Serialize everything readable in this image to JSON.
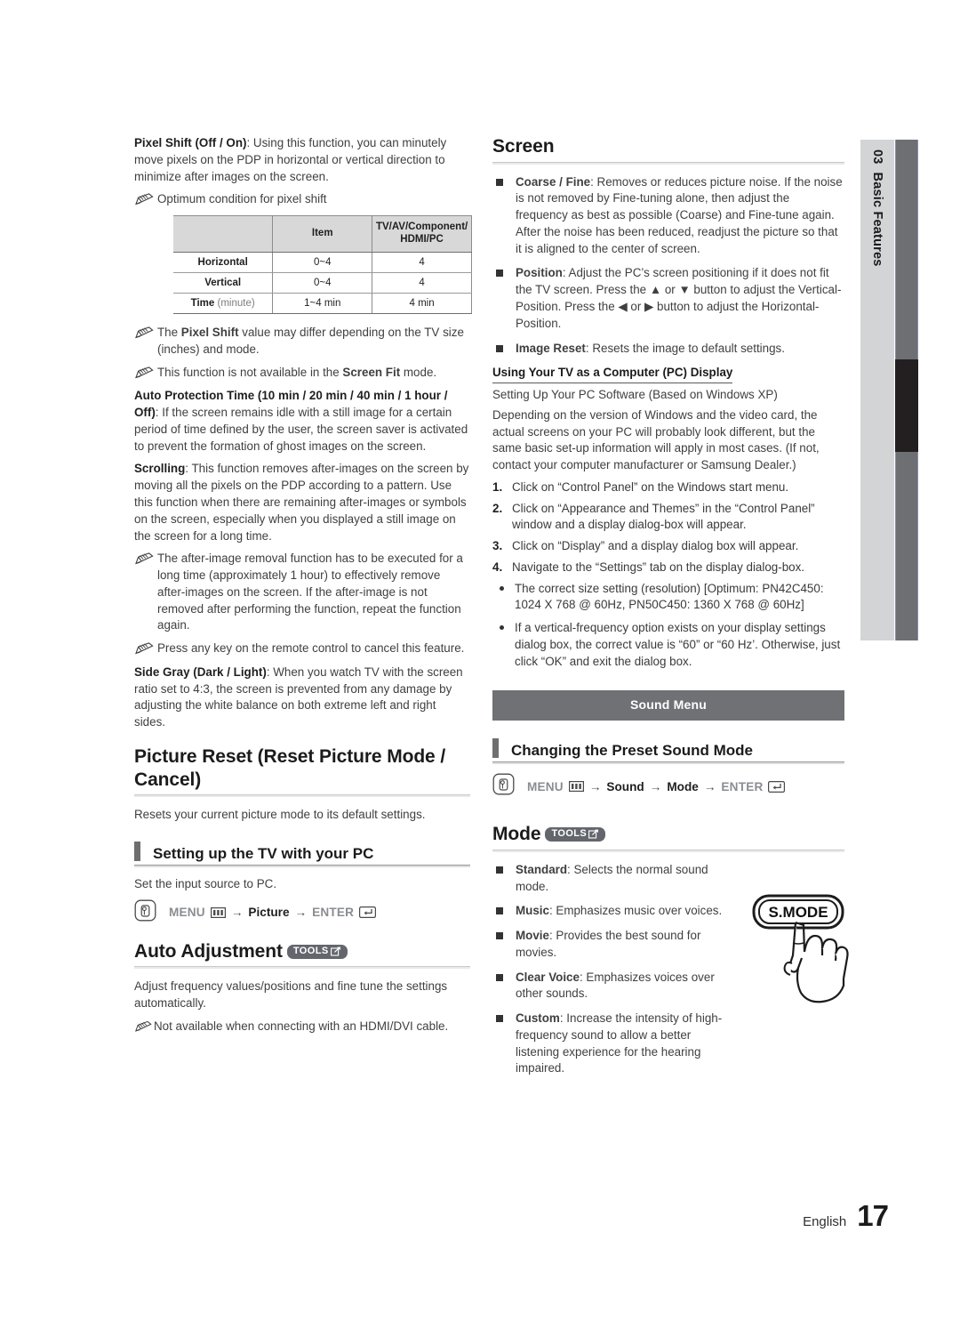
{
  "chapter_tab": {
    "number": "03",
    "name": "Basic Features"
  },
  "left_column": {
    "pixel_shift": {
      "term": "Pixel Shift (Off / On)",
      "text": ": Using this function, you can minutely move pixels on the PDP in horizontal or vertical direction to minimize after images on the screen."
    },
    "pixel_shift_note": "Optimum condition for pixel shift",
    "table": {
      "headers": [
        "",
        "Item",
        "TV/AV/Component/ HDMI/PC"
      ],
      "header_col2": "Item",
      "header_col3_line1": "TV/AV/Component/",
      "header_col3_line2": "HDMI/PC",
      "rows": [
        {
          "label": "Horizontal",
          "label_suffix": "",
          "item": "0~4",
          "value": "4"
        },
        {
          "label": "Vertical",
          "label_suffix": "",
          "item": "0~4",
          "value": "4"
        },
        {
          "label": "Time",
          "label_suffix": " (minute)",
          "item": "1~4 min",
          "value": "4 min"
        }
      ]
    },
    "note_pixel_shift_value": {
      "pre": "The ",
      "bold": "Pixel Shift",
      "post": " value may differ depending on the TV size (inches) and mode."
    },
    "note_screen_fit": {
      "pre": "This function is not available in the ",
      "bold": "Screen Fit",
      "post": " mode."
    },
    "auto_protection": {
      "term": "Auto Protection Time (10 min / 20 min / 40 min / 1 hour / Off)",
      "text": ": If the screen remains idle with a still image for a certain period of time defined by the user, the screen saver is activated to prevent the formation of ghost images on the screen."
    },
    "scrolling": {
      "term": "Scrolling",
      "text": ": This function removes after-images on the screen by moving all the pixels on the PDP according to a pattern. Use this function when there are remaining after-images or symbols on the screen, especially when you displayed a still image on the screen for a long time."
    },
    "note_after_image": "The after-image removal function has to be executed for a long time (approximately 1 hour) to effectively remove after-images on the screen. If the after-image is not removed after performing the function, repeat the function again.",
    "note_press_any_key": "Press any key on the remote control to cancel this feature.",
    "side_gray": {
      "term": "Side Gray (Dark / Light)",
      "text": ": When you watch TV with the screen ratio set to 4:3, the screen is prevented from any damage by adjusting the white balance on both extreme left and right sides."
    },
    "picture_reset": {
      "heading_line1": "Picture Reset (Reset Picture Mode /",
      "heading_line2": "Cancel)",
      "body": "Resets your current picture mode to its default settings."
    },
    "setting_up_pc": {
      "heading": "Setting up the TV with your PC",
      "body": "Set the input source to PC.",
      "nav": {
        "menu_label": "MENU",
        "arrow": "→",
        "step2": "Picture",
        "enter_label": "ENTER"
      }
    },
    "auto_adjustment": {
      "heading": "Auto Adjustment",
      "tools_label": "TOOLS",
      "body": "Adjust frequency values/positions and fine tune the settings automatically.",
      "note": "Not available when connecting with an HDMI/DVI cable."
    }
  },
  "right_column": {
    "screen": {
      "heading": "Screen",
      "bullets": [
        {
          "term": "Coarse / Fine",
          "text": ": Removes or reduces picture noise. If the noise is not removed by Fine-tuning alone, then adjust the frequency as best as possible (Coarse) and Fine-tune again. After the noise has been reduced, readjust the picture so that it is aligned to the center of screen."
        },
        {
          "term": "Position",
          "text": ": Adjust the PC’s screen positioning if it does not fit the TV screen. Press the ▲ or ▼ button to adjust the Vertical-Position. Press the ◀ or ▶ button to adjust the Horizontal-Position."
        },
        {
          "term": "Image Reset",
          "text": ": Resets the image to default settings."
        }
      ]
    },
    "pc_display": {
      "heading": "Using Your TV as a Computer (PC) Display",
      "subheading": "Setting Up Your PC Software (Based on Windows XP)",
      "intro": "Depending on the version of Windows and the video card, the actual screens on your PC will probably look different, but the same basic set-up information will apply in most cases. (If not, contact your computer manufacturer or Samsung Dealer.)",
      "steps": [
        {
          "num": "1.",
          "text": "Click on “Control Panel” on the Windows start menu."
        },
        {
          "num": "2.",
          "text": "Click on “Appearance and Themes” in the “Control Panel” window and a display dialog-box will appear."
        },
        {
          "num": "3.",
          "text": "Click on “Display” and a display dialog box will appear."
        },
        {
          "num": "4.",
          "text": "Navigate to the “Settings” tab on the display dialog-box."
        }
      ],
      "notes": [
        "The correct size setting (resolution) [Optimum: PN42C450: 1024 X 768 @ 60Hz, PN50C450: 1360 X 768 @ 60Hz]",
        "If a vertical-frequency option exists on your display settings dialog box, the correct value is “60” or “60 Hz’. Otherwise, just click “OK” and exit the dialog box."
      ]
    },
    "sound_menu_banner": "Sound Menu",
    "preset_sound_mode": {
      "heading": "Changing the Preset Sound Mode",
      "nav": {
        "menu_label": "MENU",
        "arrow": "→",
        "step2": "Sound",
        "step3": "Mode",
        "enter_label": "ENTER"
      }
    },
    "mode": {
      "heading": "Mode",
      "tools_label": "TOOLS",
      "bullets": [
        {
          "term": "Standard",
          "text": ": Selects the normal sound mode."
        },
        {
          "term": "Music",
          "text": ": Emphasizes music over voices."
        },
        {
          "term": "Movie",
          "text": ": Provides the best sound for movies."
        },
        {
          "term": "Clear Voice",
          "text": ": Emphasizes voices over other sounds."
        },
        {
          "term": "Custom",
          "text": ": Increase the intensity of high-frequency sound to allow a better listening experience for the hearing impaired."
        }
      ]
    },
    "remote_button_label": "S.MODE"
  },
  "footer": {
    "language": "English",
    "page_number": "17"
  },
  "colors": {
    "tab_light": "#d2d4d5",
    "tab_bar": "#6d6f73",
    "tab_active": "#231f20",
    "banner": "#6f7175",
    "tools_badge": "#63666c"
  }
}
